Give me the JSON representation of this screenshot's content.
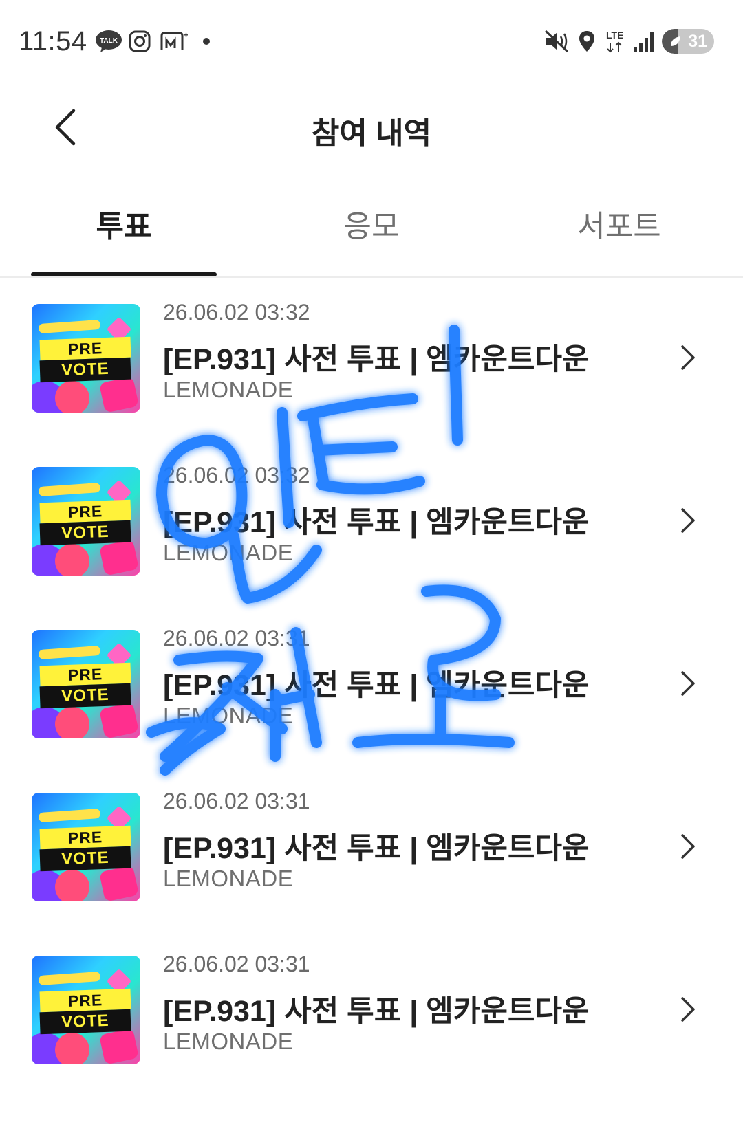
{
  "status_bar": {
    "time": "11:54",
    "battery": "31",
    "battery_level": 0.31,
    "icons": [
      "kakaotalk-icon",
      "instagram-icon",
      "mnet-icon",
      "notification-dot-icon",
      "mute-icon",
      "location-icon",
      "lte-signal-icon",
      "battery-icon"
    ],
    "network": "LTE"
  },
  "header": {
    "title": "참여 내역",
    "back_icon": "chevron-left-icon"
  },
  "tabs": [
    {
      "label": "투표",
      "active": true
    },
    {
      "label": "응모",
      "active": false
    },
    {
      "label": "서포트",
      "active": false
    }
  ],
  "thumbnail": {
    "pre": "PRE",
    "vote": "VOTE"
  },
  "items": [
    {
      "date": "26.06.02 03:32",
      "title": "[EP.931] 사전 투표 | 엠카운트다운",
      "artist": "LEMONADE"
    },
    {
      "date": "26.06.02 03:32",
      "title": "[EP.931] 사전 투표 | 엠카운트다운",
      "artist": "LEMONADE"
    },
    {
      "date": "26.06.02 03:31",
      "title": "[EP.931] 사전 투표 | 엠카운트다운",
      "artist": "LEMONADE"
    },
    {
      "date": "26.06.02 03:31",
      "title": "[EP.931] 사전 투표 | 엠카운트다운",
      "artist": "LEMONADE"
    },
    {
      "date": "26.06.02 03:31",
      "title": "[EP.931] 사전 투표 | 엠카운트다운",
      "artist": "LEMONADE"
    }
  ],
  "colors": {
    "accent": "#1a1a1a",
    "scribble": "#1f7cff"
  }
}
